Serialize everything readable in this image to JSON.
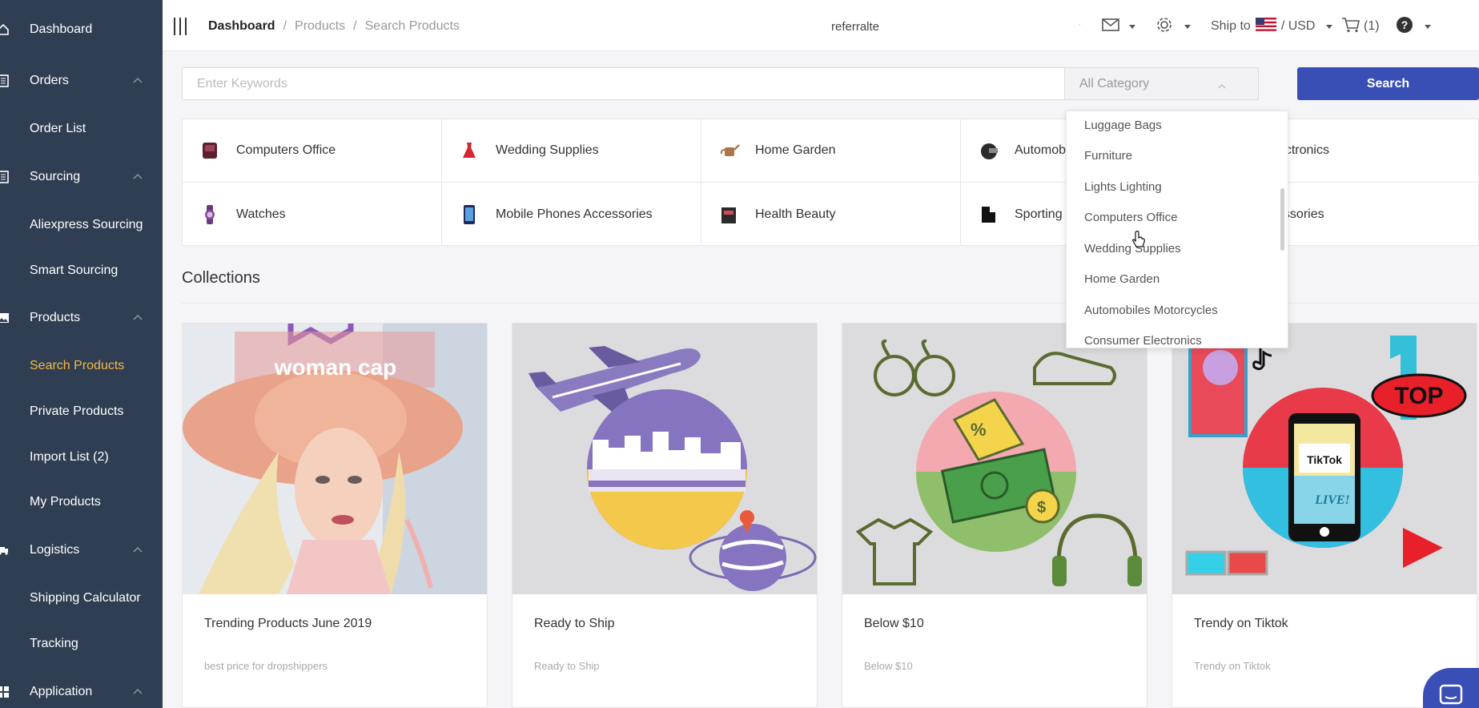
{
  "sidebar": {
    "items": [
      {
        "label": "Dashboard",
        "icon": "home-icon"
      },
      {
        "label": "Orders",
        "icon": "list-icon"
      },
      {
        "label": "Order List"
      },
      {
        "label": "Sourcing",
        "icon": "list-icon"
      },
      {
        "label": "Aliexpress Sourcing"
      },
      {
        "label": "Smart Sourcing"
      },
      {
        "label": "Products",
        "icon": "image-icon"
      },
      {
        "label": "Search Products"
      },
      {
        "label": "Private Products"
      },
      {
        "label": "Import List (2)"
      },
      {
        "label": "My Products"
      },
      {
        "label": "Logistics",
        "icon": "truck-icon"
      },
      {
        "label": "Shipping Calculator"
      },
      {
        "label": "Tracking"
      },
      {
        "label": "Application",
        "icon": "grid-icon"
      }
    ],
    "active_color": "#f5b942",
    "bg_color": "#2f3e52"
  },
  "breadcrumb": {
    "home": "Dashboard",
    "sep": "/",
    "mid": "Products",
    "current": "Search Products"
  },
  "topbar": {
    "referral": "referralte",
    "ship_to": "Ship to",
    "currency": "/ USD",
    "cart_count": "(1)",
    "flag": "us-flag-icon"
  },
  "search": {
    "placeholder": "Enter Keywords",
    "category_placeholder": "All Category",
    "button": "Search"
  },
  "categories": [
    {
      "label": "Computers Office",
      "icon": "computer-icon"
    },
    {
      "label": "Wedding Supplies",
      "icon": "dress-icon"
    },
    {
      "label": "Home Garden",
      "icon": "watering-can-icon"
    },
    {
      "label": "Automob",
      "icon": "helmet-icon"
    },
    {
      "label": "onsumer Electronics",
      "icon": ""
    },
    {
      "label": "Watches",
      "icon": "watch-icon"
    },
    {
      "label": "Mobile Phones Accessories",
      "icon": "phone-icon"
    },
    {
      "label": "Health Beauty",
      "icon": "cosmetics-icon"
    },
    {
      "label": "Sporting",
      "icon": "sport-icon"
    },
    {
      "label": "blets Accessories",
      "icon": ""
    }
  ],
  "dropdown": {
    "items": [
      "Luggage Bags",
      "Furniture",
      "Lights Lighting",
      "Computers Office",
      "Wedding Supplies",
      "Home Garden",
      "Automobiles Motorcycles",
      "Consumer Electronics"
    ]
  },
  "collections": {
    "title": "Collections",
    "cards": [
      {
        "title": "Trending Products June 2019",
        "subtitle": "best price for dropshippers",
        "overlay": "woman cap"
      },
      {
        "title": "Ready to Ship",
        "subtitle": "Ready to Ship"
      },
      {
        "title": "Below $10",
        "subtitle": "Below $10"
      },
      {
        "title": "Trendy on Tiktok",
        "subtitle": "Trendy on Tiktok",
        "badge": "TOP",
        "number": "1",
        "app": "TikTok",
        "live": "LIVE!"
      }
    ]
  },
  "colors": {
    "primary": "#3a4fb5",
    "accent": "#f5b942"
  }
}
